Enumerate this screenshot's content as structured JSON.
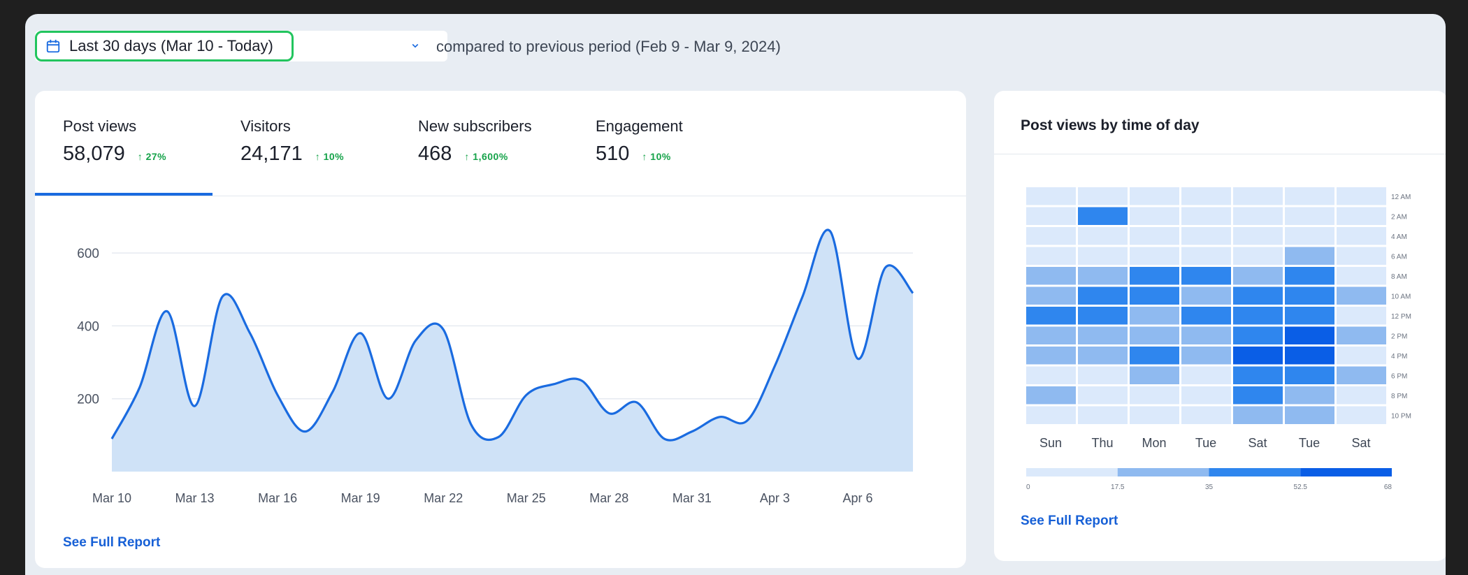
{
  "filter": {
    "range_label": "Last 30 days (Mar 10 - Today)",
    "compare_label": "compared to previous period (Feb 9 - Mar 9, 2024)"
  },
  "tabs": [
    {
      "label": "Post views",
      "value": "58,079",
      "delta": "27%"
    },
    {
      "label": "Visitors",
      "value": "24,171",
      "delta": "10%"
    },
    {
      "label": "New subscribers",
      "value": "468",
      "delta": "1,600%"
    },
    {
      "label": "Engagement",
      "value": "510",
      "delta": "10%"
    }
  ],
  "main_chart": {
    "see_full_report": "See Full Report"
  },
  "heatmap_card": {
    "title": "Post views by time of day",
    "see_full_report": "See Full Report"
  },
  "colors": {
    "accent": "#1a6be0",
    "positive": "#16a34a",
    "area_fill": "#cfe2f7",
    "highlight": "#22c55e"
  },
  "chart_data": [
    {
      "type": "area",
      "title": "",
      "xlabel": "",
      "ylabel": "",
      "ylim": [
        0,
        700
      ],
      "y_ticks": [
        200,
        400,
        600
      ],
      "x_tick_labels": [
        "Mar 10",
        "Mar 13",
        "Mar 16",
        "Mar 19",
        "Mar 22",
        "Mar 25",
        "Mar 28",
        "Mar 31",
        "Apr 3",
        "Apr 6"
      ],
      "grid": true,
      "series": [
        {
          "values": [
            90,
            230,
            440,
            180,
            480,
            380,
            210,
            110,
            220,
            380,
            200,
            360,
            390,
            130,
            95,
            210,
            240,
            250,
            160,
            190,
            90,
            110,
            150,
            140,
            290,
            480,
            660,
            310,
            560,
            490
          ]
        }
      ]
    },
    {
      "type": "heatmap",
      "title": "Post views by time of day",
      "columns": [
        "Sun",
        "Thu",
        "Mon",
        "Tue",
        "Sat",
        "Tue",
        "Sat"
      ],
      "rows": [
        "12 AM",
        "2 AM",
        "4 AM",
        "6 AM",
        "8 AM",
        "10 AM",
        "12 PM",
        "2 PM",
        "4 PM",
        "6 PM",
        "8 PM",
        "10 PM"
      ],
      "color_scale_ticks": [
        "0",
        "17.5",
        "35",
        "52.5",
        "68"
      ],
      "color_scale_range": [
        0,
        68
      ],
      "values": [
        [
          6,
          6,
          6,
          6,
          6,
          6,
          6
        ],
        [
          6,
          48,
          6,
          6,
          6,
          6,
          6
        ],
        [
          6,
          6,
          6,
          6,
          6,
          6,
          6
        ],
        [
          6,
          6,
          6,
          6,
          6,
          25,
          6
        ],
        [
          28,
          28,
          48,
          48,
          28,
          48,
          6
        ],
        [
          28,
          48,
          48,
          28,
          48,
          48,
          28
        ],
        [
          48,
          48,
          28,
          48,
          48,
          48,
          6
        ],
        [
          28,
          28,
          28,
          28,
          48,
          62,
          28
        ],
        [
          28,
          28,
          48,
          28,
          62,
          62,
          6
        ],
        [
          6,
          6,
          28,
          6,
          48,
          48,
          28
        ],
        [
          28,
          6,
          6,
          6,
          48,
          28,
          6
        ],
        [
          6,
          6,
          6,
          6,
          28,
          28,
          6
        ]
      ]
    }
  ]
}
